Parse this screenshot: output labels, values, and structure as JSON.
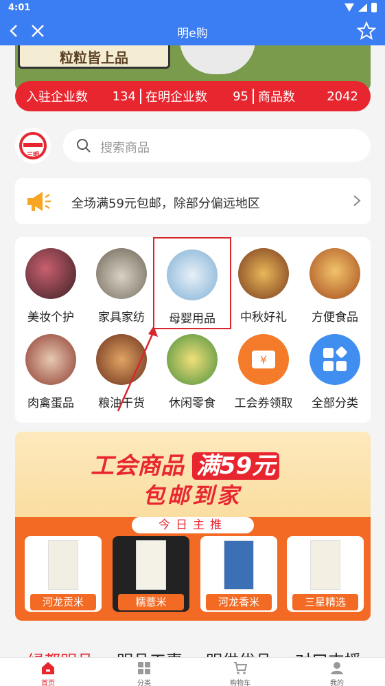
{
  "status_bar": {
    "time": "4:01"
  },
  "header": {
    "title": "明e购"
  },
  "banner": {
    "slogan": "粒粒皆上品"
  },
  "stats": [
    {
      "label": "入驻企业数",
      "value": "134"
    },
    {
      "label": "在明企业数",
      "value": "95"
    },
    {
      "label": "商品数",
      "value": "2042"
    }
  ],
  "logo": {
    "text": "三明"
  },
  "search": {
    "placeholder": "搜索商品"
  },
  "notice": {
    "text": "全场满59元包邮，除部分偏远地区"
  },
  "categories": [
    {
      "label": "美妆个护"
    },
    {
      "label": "家具家纺"
    },
    {
      "label": "母婴用品"
    },
    {
      "label": "中秋好礼"
    },
    {
      "label": "方便食品"
    },
    {
      "label": "肉禽蛋品"
    },
    {
      "label": "粮油干货"
    },
    {
      "label": "休闲零食"
    },
    {
      "label": "工会券领取"
    },
    {
      "label": "全部分类"
    }
  ],
  "promo": {
    "headline_prefix": "工会商品",
    "headline_boxed": "满59元",
    "headline2": "包邮到家",
    "today": "今日主推",
    "products": [
      {
        "tag": "河龙贡米"
      },
      {
        "tag": "糯薏米"
      },
      {
        "tag": "河龙香米"
      },
      {
        "tag": "三星精选"
      }
    ]
  },
  "section_tabs": [
    "绿都明品",
    "明品工惠",
    "明供优品",
    "对口支援"
  ],
  "bottom_nav": [
    {
      "label": "首页",
      "icon": "home-icon"
    },
    {
      "label": "分类",
      "icon": "grid-icon"
    },
    {
      "label": "购物车",
      "icon": "cart-icon"
    },
    {
      "label": "我的",
      "icon": "user-icon"
    }
  ],
  "colors": {
    "header_blue": "#3b7df2",
    "accent_red": "#e8262f",
    "promo_orange": "#f26a24"
  }
}
